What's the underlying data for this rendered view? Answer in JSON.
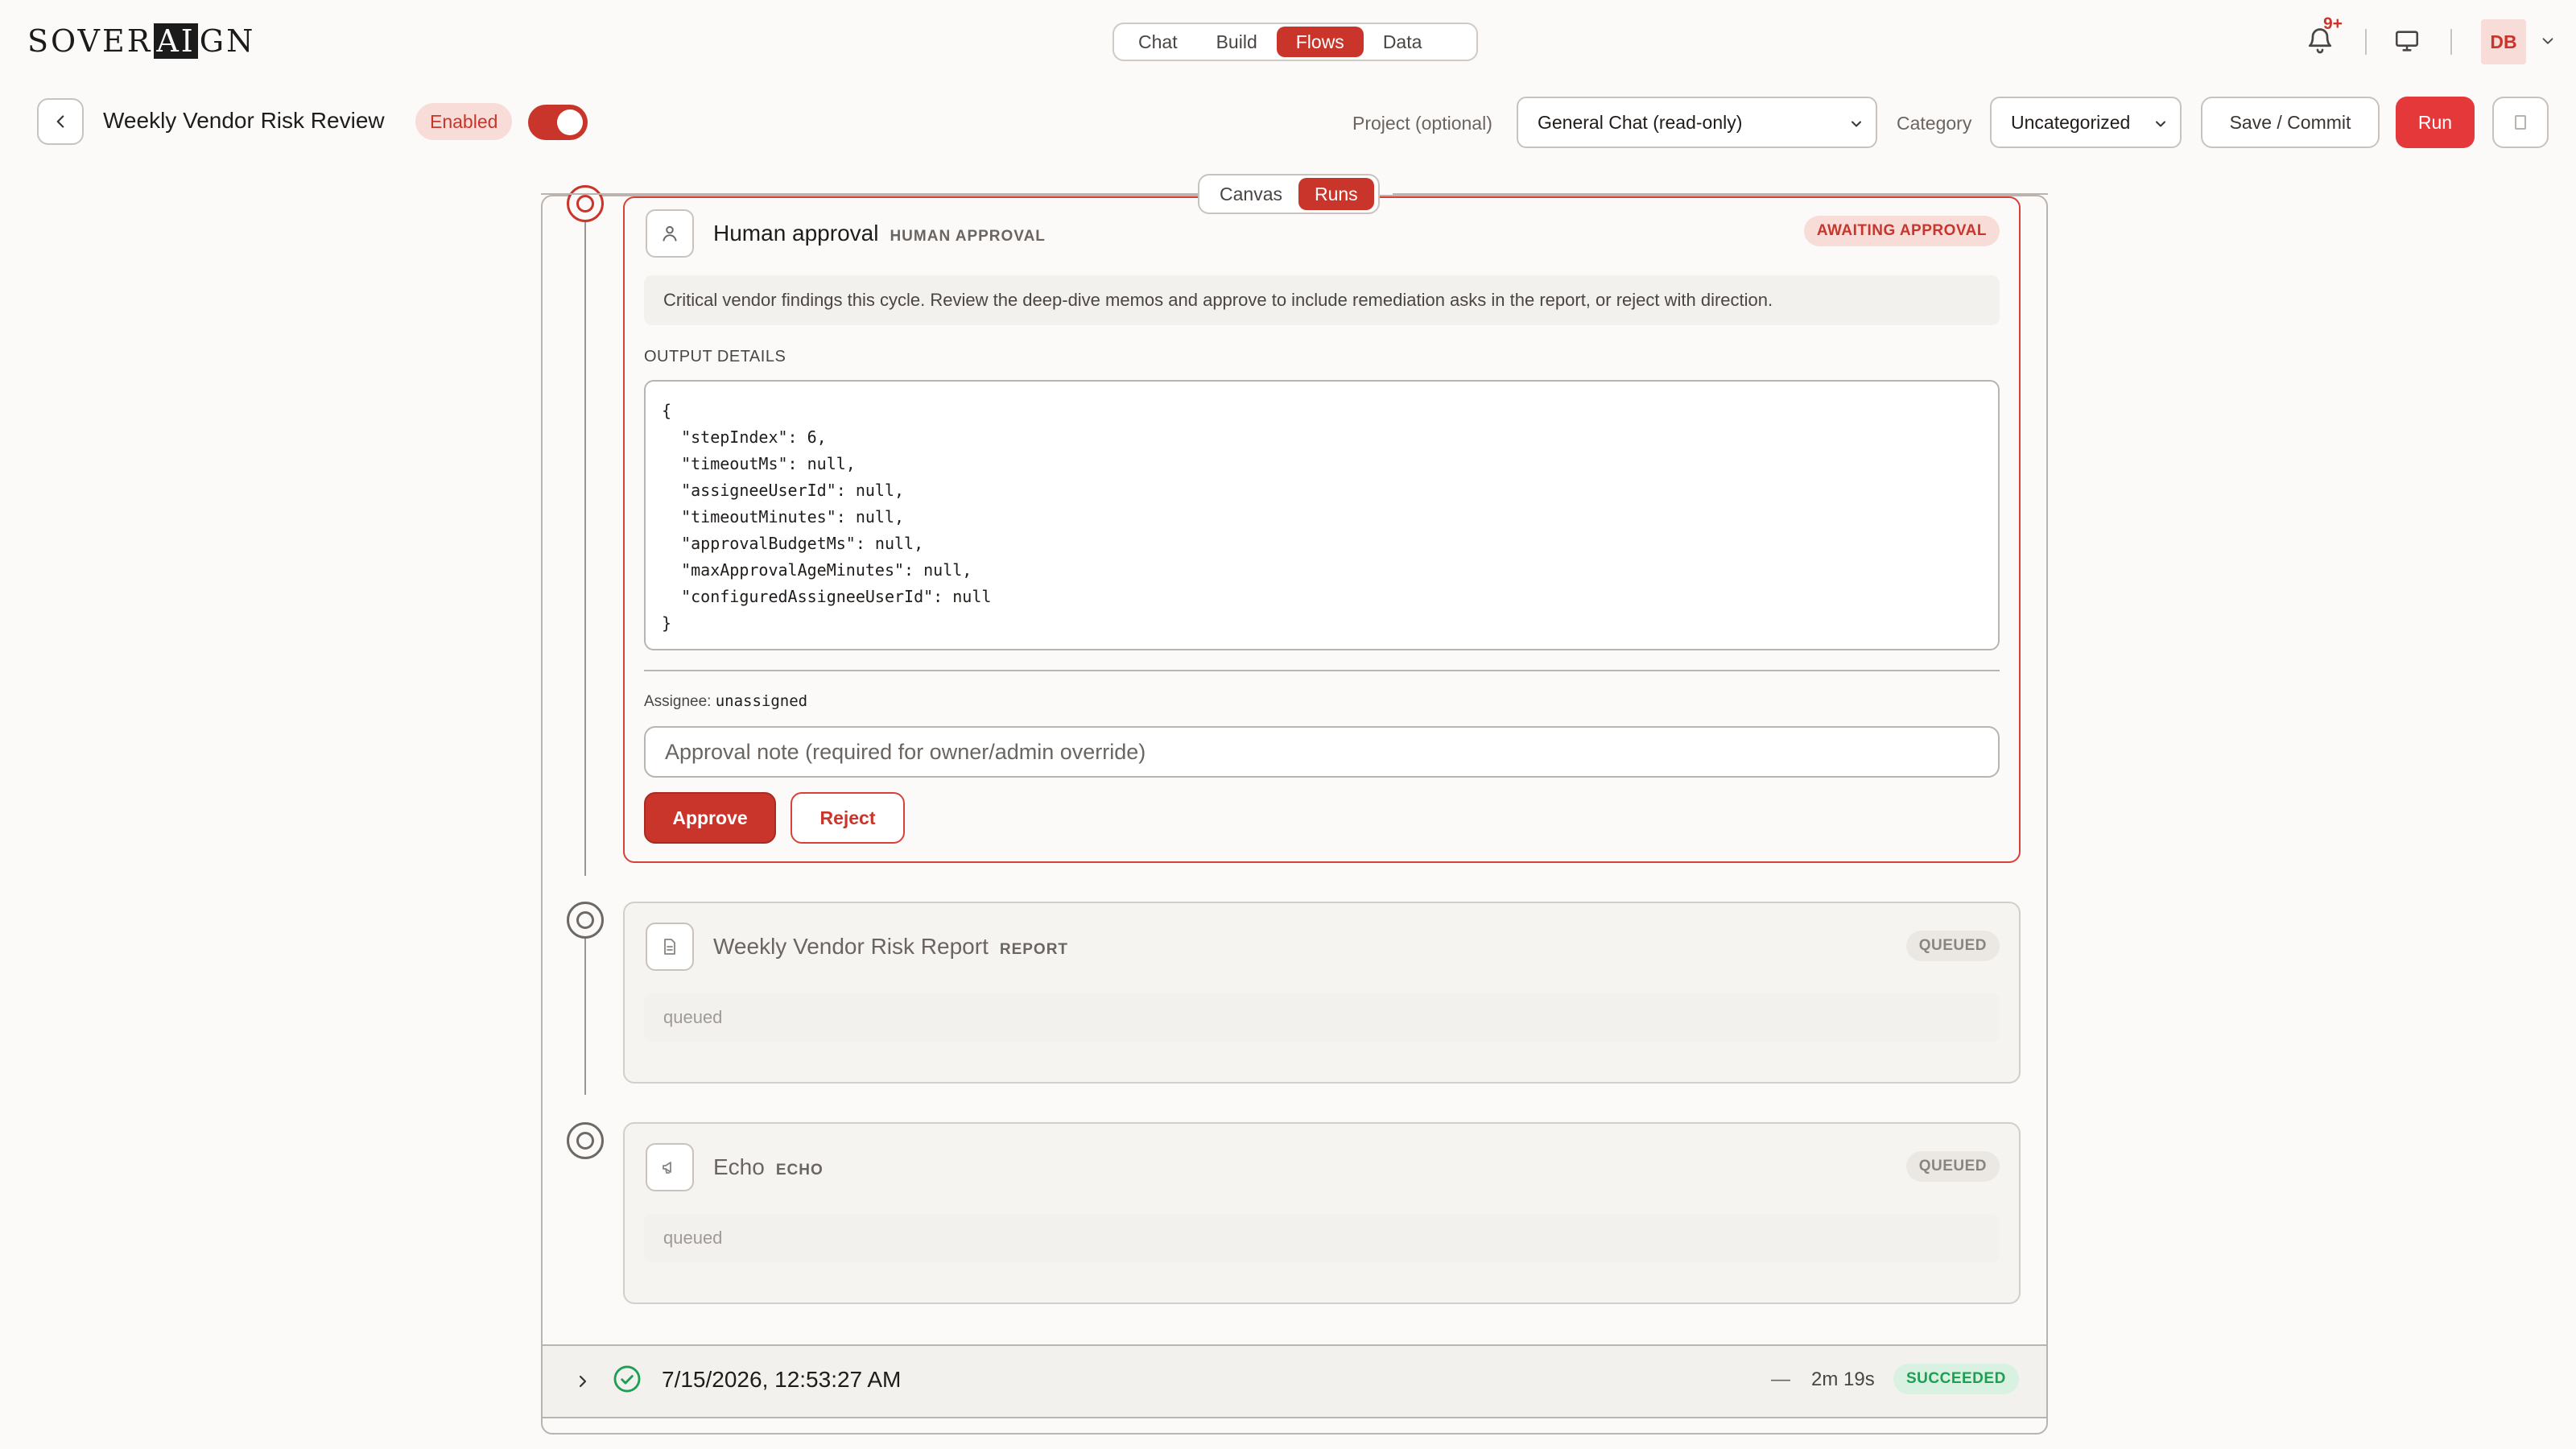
{
  "app": {
    "logo_pre": "SOVER",
    "logo_hl": "AI",
    "logo_post": "GN"
  },
  "nav": {
    "tabs": [
      "Chat",
      "Build",
      "Flows",
      "Data"
    ],
    "active": "Flows"
  },
  "notifications": {
    "badge": "9+",
    "icon": "bell-icon"
  },
  "user": {
    "initials": "DB"
  },
  "flow": {
    "title": "Weekly Vendor Risk Review",
    "status_label": "Enabled",
    "enabled": true
  },
  "project": {
    "label": "Project (optional)",
    "value": "General Chat (read-only)"
  },
  "category": {
    "label": "Category",
    "value": "Uncategorized"
  },
  "actions": {
    "save": "Save / Commit",
    "run": "Run"
  },
  "view_toggle": {
    "options": [
      "Canvas",
      "Runs"
    ],
    "active": "Runs"
  },
  "steps": [
    {
      "title": "Human approval",
      "kind": "HUMAN APPROVAL",
      "status": "AWAITING APPROVAL",
      "icon": "user-icon",
      "description": "Critical vendor findings this cycle. Review the deep-dive memos and approve to include remediation asks in the report, or reject with direction.",
      "output_label": "OUTPUT DETAILS",
      "output_json": "{\n  \"stepIndex\": 6,\n  \"timeoutMs\": null,\n  \"assigneeUserId\": null,\n  \"timeoutMinutes\": null,\n  \"approvalBudgetMs\": null,\n  \"maxApprovalAgeMinutes\": null,\n  \"configuredAssigneeUserId\": null\n}",
      "assignee_label": "Assignee:",
      "assignee_value": "unassigned",
      "note_placeholder": "Approval note (required for owner/admin override)",
      "approve_label": "Approve",
      "reject_label": "Reject"
    },
    {
      "title": "Weekly Vendor Risk Report",
      "kind": "REPORT",
      "status": "QUEUED",
      "icon": "document-icon",
      "description": "queued"
    },
    {
      "title": "Echo",
      "kind": "ECHO",
      "status": "QUEUED",
      "icon": "megaphone-icon",
      "description": "queued"
    }
  ],
  "runs": [
    {
      "timestamp": "7/15/2026, 12:53:27 AM",
      "dash": "—",
      "duration": "2m 19s",
      "status": "SUCCEEDED"
    }
  ],
  "colors": {
    "accent": "#c9352a",
    "run_button": "#e5383b",
    "success": "#1e9e53"
  }
}
